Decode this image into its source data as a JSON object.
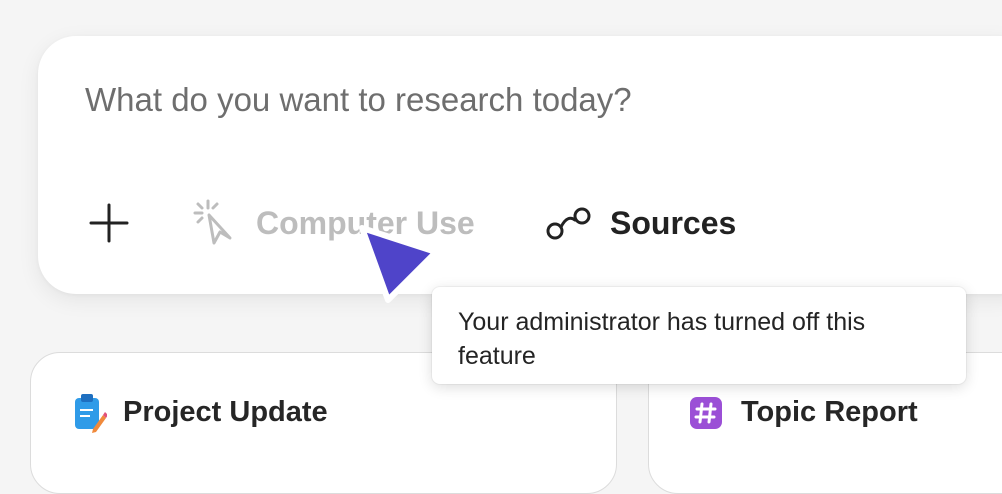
{
  "composer": {
    "placeholder": "What do you want to research today?",
    "value": ""
  },
  "toolbar": {
    "add_icon": "plus-icon",
    "computer_use": {
      "label": "Computer Use",
      "icon": "cursor-click-icon",
      "state": "disabled",
      "color": "#bdbdbd"
    },
    "sources": {
      "label": "Sources",
      "icon": "sources-link-icon",
      "color": "#222222"
    }
  },
  "tooltip": {
    "text": "Your administrator has turned off this feature"
  },
  "cursor": {
    "icon": "pointer-cursor-icon",
    "color": "#4f44c9"
  },
  "cards": [
    {
      "label": "Project Update",
      "icon": "clipboard-pencil-icon"
    },
    {
      "label": "Topic Report",
      "icon": "hashtag-icon"
    }
  ],
  "colors": {
    "page_background": "#f5f5f5",
    "card_background": "#ffffff",
    "hashtag_purple": "#9b4fd6",
    "clipboard_blue": "#2f9be8"
  }
}
